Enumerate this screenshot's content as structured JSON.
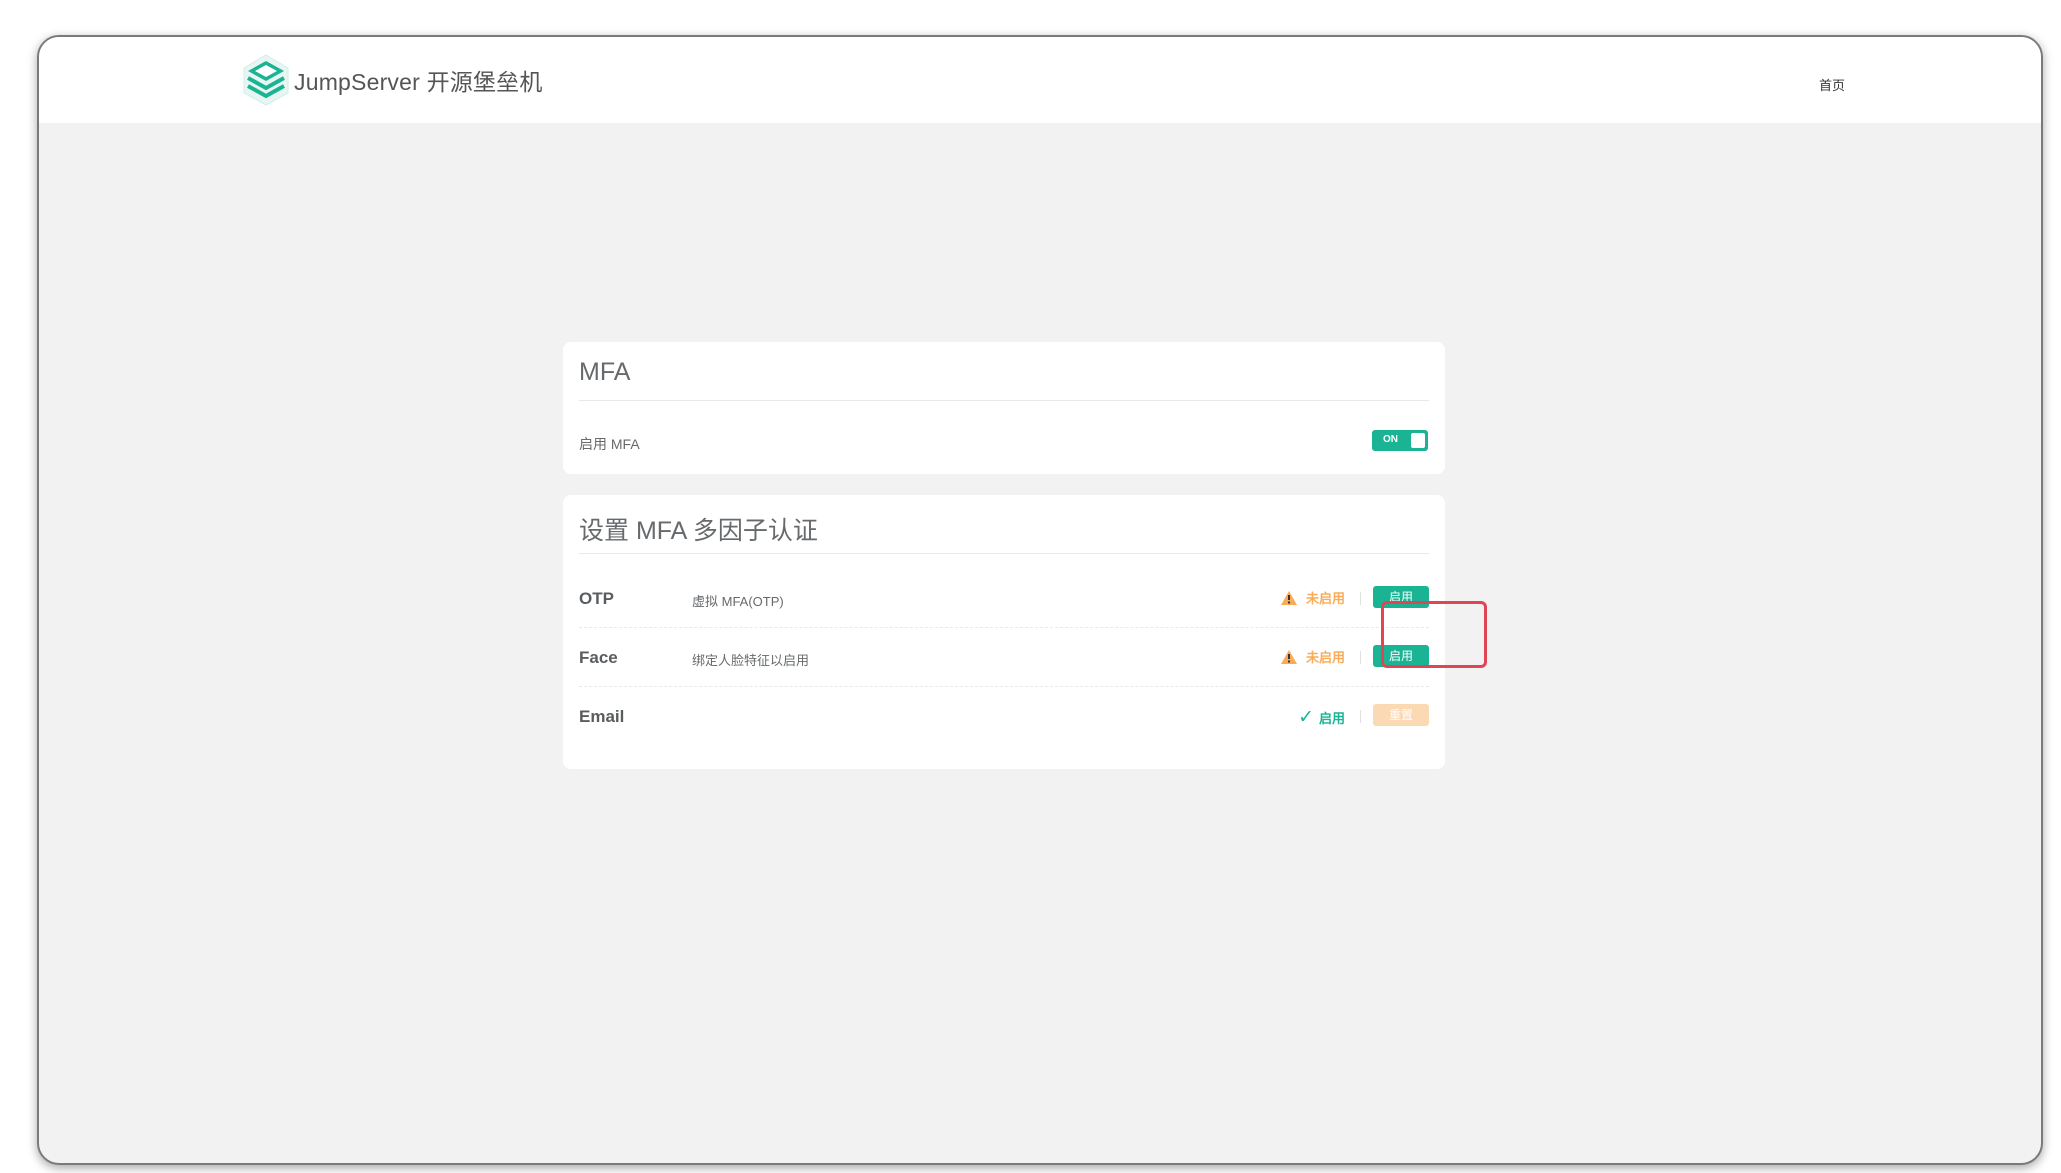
{
  "header": {
    "brand_name": "JumpServer 开源堡垒机",
    "nav_home": "首页",
    "brand_color": "#1ab394"
  },
  "mfa_card": {
    "title": "MFA",
    "enable_label": "启用 MFA",
    "switch_text": "ON",
    "switch_state": "on"
  },
  "setup_card": {
    "title": "设置 MFA 多因子认证",
    "rows": [
      {
        "name": "OTP",
        "desc": "虚拟 MFA(OTP)",
        "status": "未启用",
        "status_type": "warning",
        "action": "启用"
      },
      {
        "name": "Face",
        "desc": "绑定人脸特征以启用",
        "status": "未启用",
        "status_type": "warning",
        "action": "启用"
      },
      {
        "name": "Email",
        "desc": "",
        "status": "启用",
        "status_type": "ok",
        "action": "重置"
      }
    ]
  },
  "colors": {
    "primary": "#1ab394",
    "warning": "#f8ac59",
    "highlight": "#e04556",
    "reset_button": "#fad9b3"
  }
}
